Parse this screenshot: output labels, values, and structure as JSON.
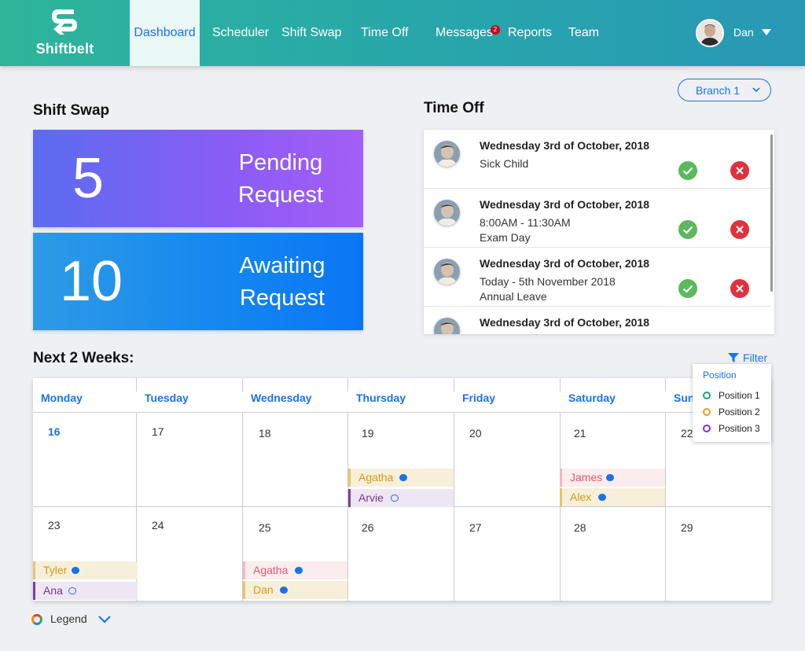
{
  "app": {
    "name": "Shiftbelt"
  },
  "nav": {
    "items": [
      {
        "label": "Dashboard"
      },
      {
        "label": "Scheduler"
      },
      {
        "label": "Shift Swap"
      },
      {
        "label": "Time Off"
      },
      {
        "label": "Messages"
      },
      {
        "label": "Reports"
      },
      {
        "label": "Team"
      }
    ],
    "messages_badge": "2"
  },
  "user": {
    "name": "Dan"
  },
  "branch": {
    "label": "Branch 1"
  },
  "shift_swap": {
    "title": "Shift Swap",
    "pending": {
      "count": "5",
      "line1": "Pending",
      "line2": "Request"
    },
    "awaiting": {
      "count": "10",
      "line1": "Awaiting",
      "line2": "Request"
    }
  },
  "time_off": {
    "title": "Time Off",
    "requests": [
      {
        "date": "Wednesday 3rd of October, 2018",
        "line1": "Sick Child",
        "line2": ""
      },
      {
        "date": "Wednesday 3rd of October, 2018",
        "line1": "8:00AM - 11:30AM",
        "line2": "Exam Day"
      },
      {
        "date": "Wednesday 3rd of October, 2018",
        "line1": "Today - 5th November 2018",
        "line2": "Annual Leave"
      },
      {
        "date": "Wednesday 3rd of October, 2018",
        "line1": "",
        "line2": ""
      }
    ]
  },
  "calendar": {
    "title": "Next 2 Weeks:",
    "filter_label": "Filter",
    "days": [
      "Monday",
      "Tuesday",
      "Wednesday",
      "Thursday",
      "Friday",
      "Saturday",
      "Sun"
    ],
    "week1": [
      "16",
      "17",
      "18",
      "19",
      "20",
      "21",
      "22"
    ],
    "week2": [
      "23",
      "24",
      "25",
      "26",
      "27",
      "28",
      "29"
    ],
    "shifts": {
      "thu1_a": "Agatha",
      "thu1_b": "Arvie",
      "sat1_a": "James",
      "sat1_b": "Alex",
      "mon2_a": "Tyler",
      "mon2_b": "Ana",
      "wed2_a": "Agatha",
      "wed2_b": "Dan"
    }
  },
  "position_filter": {
    "title": "Position",
    "items": [
      "Position 1",
      "Position 2",
      "Position 3"
    ],
    "colors": [
      "#1aa37a",
      "#f39c12",
      "#8e2de2"
    ]
  },
  "legend": {
    "label": "Legend"
  },
  "colors": {
    "accent": "#1a73e8",
    "approve": "#5cb85c",
    "reject": "#e0323e",
    "shift_yellow": "#f7efd9",
    "shift_purple": "#efe6f4",
    "shift_pink": "#fbecee"
  }
}
